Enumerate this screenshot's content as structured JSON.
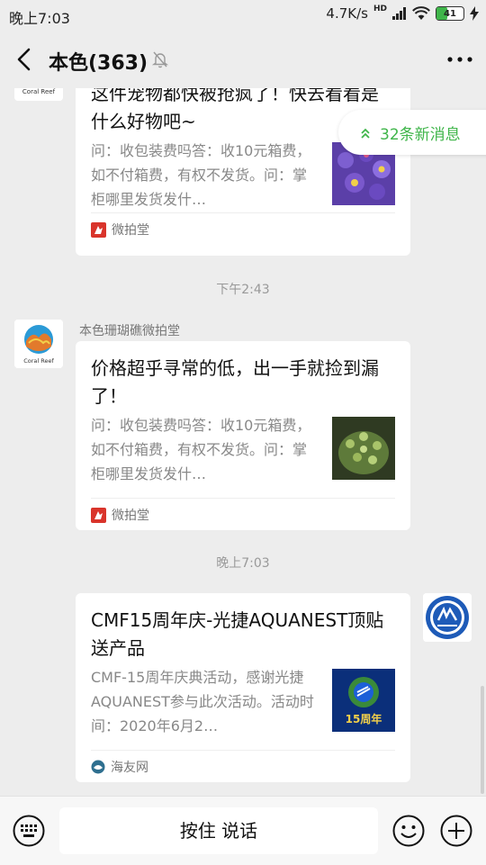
{
  "status": {
    "time": "晚上7:03",
    "speed": "4.7K/s",
    "hd": "HD",
    "battery": "41"
  },
  "header": {
    "title": "本色(363)"
  },
  "new_messages": "32条新消息",
  "messages": [
    {
      "title": "这件宠物都快被抢疯了！快去看看是什么好物吧~",
      "desc": "问：收包装费吗答：收10元箱费，如不付箱费，有权不发货。问：掌柜哪里发货发什…",
      "source": "微拍堂"
    },
    {
      "time": "下午2:43",
      "sender": "本色珊瑚礁微拍堂",
      "title": "价格超乎寻常的低，出一手就捡到漏了！",
      "desc": "问：收包装费吗答：收10元箱费，如不付箱费，有权不发货。问：掌柜哪里发货发什…",
      "source": "微拍堂",
      "avatar_text": "Coral Reef"
    },
    {
      "time": "晚上7:03",
      "title": "CMF15周年庆-光捷AQUANEST顶贴送产品",
      "desc": "CMF-15周年庆典活动，感谢光捷AQUANEST参与此次活动。活动时间：2020年6月2…",
      "source": "海友网",
      "thumb_text": "15周年"
    }
  ],
  "input": {
    "hold_to_talk": "按住 说话"
  },
  "colors": {
    "accent": "#3fb54a",
    "bg": "#ededed"
  }
}
